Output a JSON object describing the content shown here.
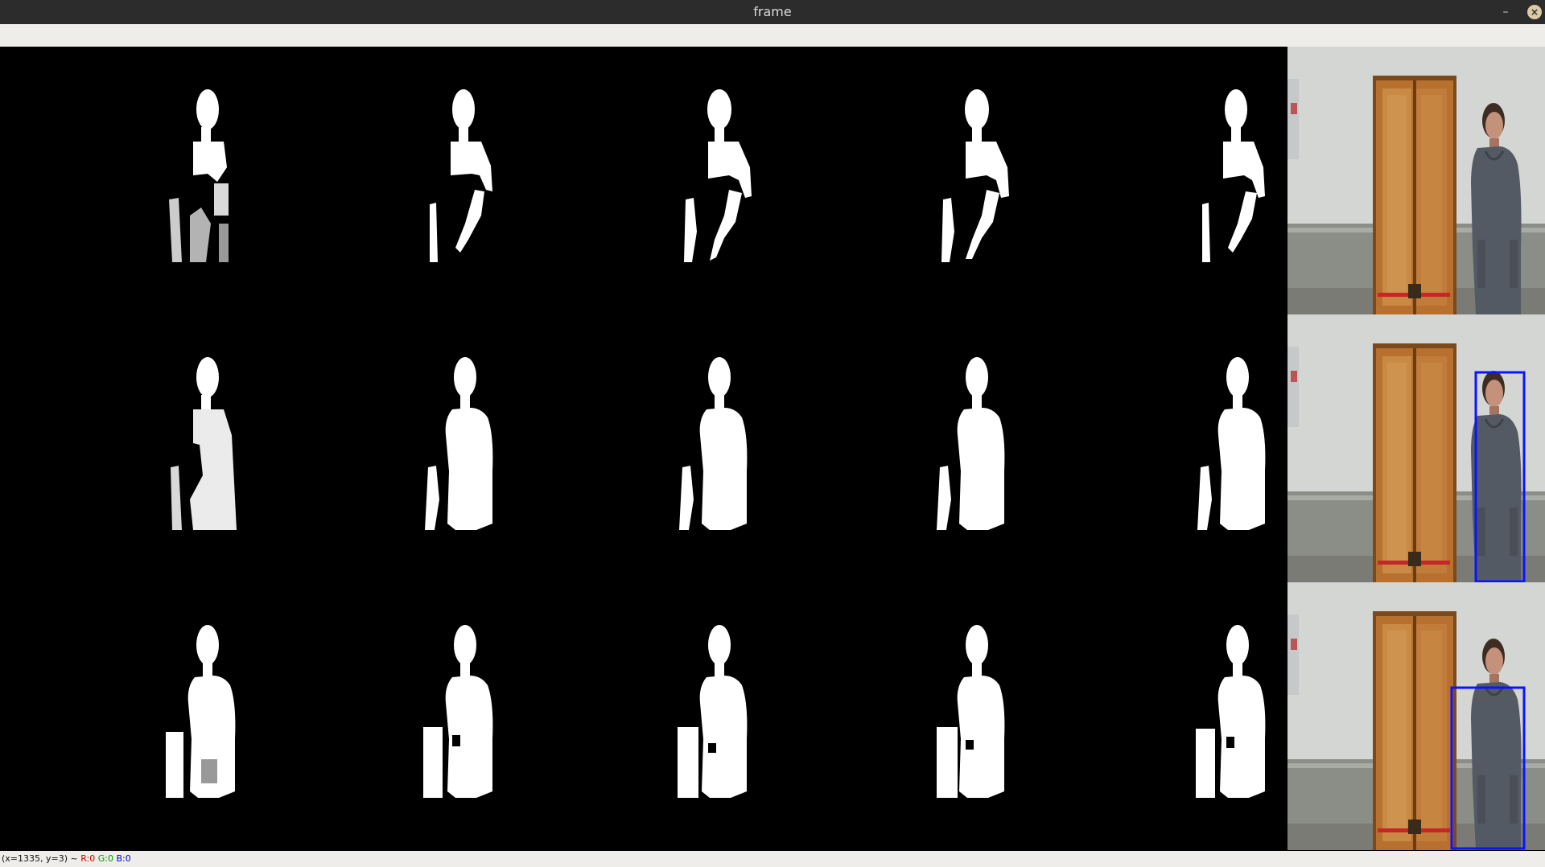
{
  "window": {
    "title": "frame"
  },
  "controls": {
    "minimize_glyph": "–",
    "close_glyph": "×"
  },
  "status": {
    "coords": "(x=1335, y=3) ~",
    "r": "R:0",
    "g": "G:0",
    "b": "B:0"
  },
  "colors": {
    "titlebar": "#2c2c2c",
    "toolbar": "#efede9",
    "mask_background": "#000000",
    "mask_foreground": "#ffffff",
    "detection_box": "#0a14ff"
  },
  "grid": {
    "mask_rows": 3,
    "mask_columns": 5,
    "camera_panels": 3,
    "detections_per_panel": [
      0,
      1,
      1
    ]
  }
}
